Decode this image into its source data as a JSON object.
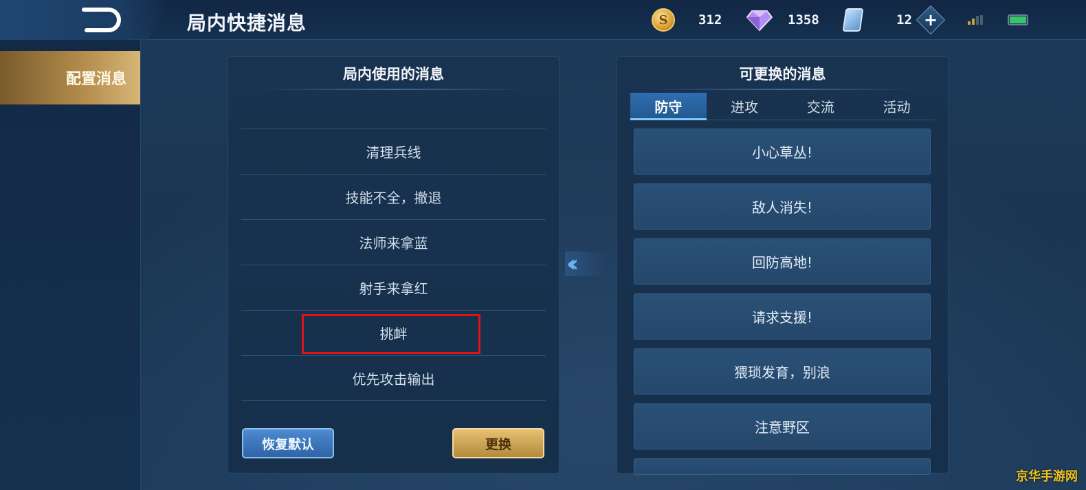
{
  "header": {
    "title": "局内快捷消息",
    "coins": "312",
    "diamonds": "1358",
    "tickets": "12"
  },
  "sidebar": {
    "items": [
      {
        "label": "配置消息",
        "active": true
      }
    ]
  },
  "left_panel": {
    "title": "局内使用的消息",
    "messages": [
      "清理兵线",
      "技能不全，撤退",
      "法师来拿蓝",
      "射手来拿红",
      "挑衅",
      "优先攻击输出"
    ],
    "highlighted_message": "挑衅",
    "reset_button": "恢复默认",
    "replace_button": "更换"
  },
  "right_panel": {
    "title": "可更换的消息",
    "tabs": [
      "防守",
      "进攻",
      "交流",
      "活动"
    ],
    "active_tab": "防守",
    "options": [
      "小心草丛!",
      "敌人消失!",
      "回防高地!",
      "请求支援!",
      "猥琐发育，别浪",
      "注意野区"
    ]
  },
  "icons": {
    "back": "back-arrow-icon",
    "coin": "gold-coin-icon",
    "diamond": "diamond-icon",
    "ticket": "card-ticket-icon",
    "add": "plus-icon",
    "signal": "signal-icon",
    "battery": "battery-icon",
    "move": "double-chevron-left-icon"
  },
  "colors": {
    "accent_blue": "#2f6eb0",
    "gold": "#d7b577",
    "highlight_red": "#e0131b"
  },
  "watermark": "京华手游网"
}
